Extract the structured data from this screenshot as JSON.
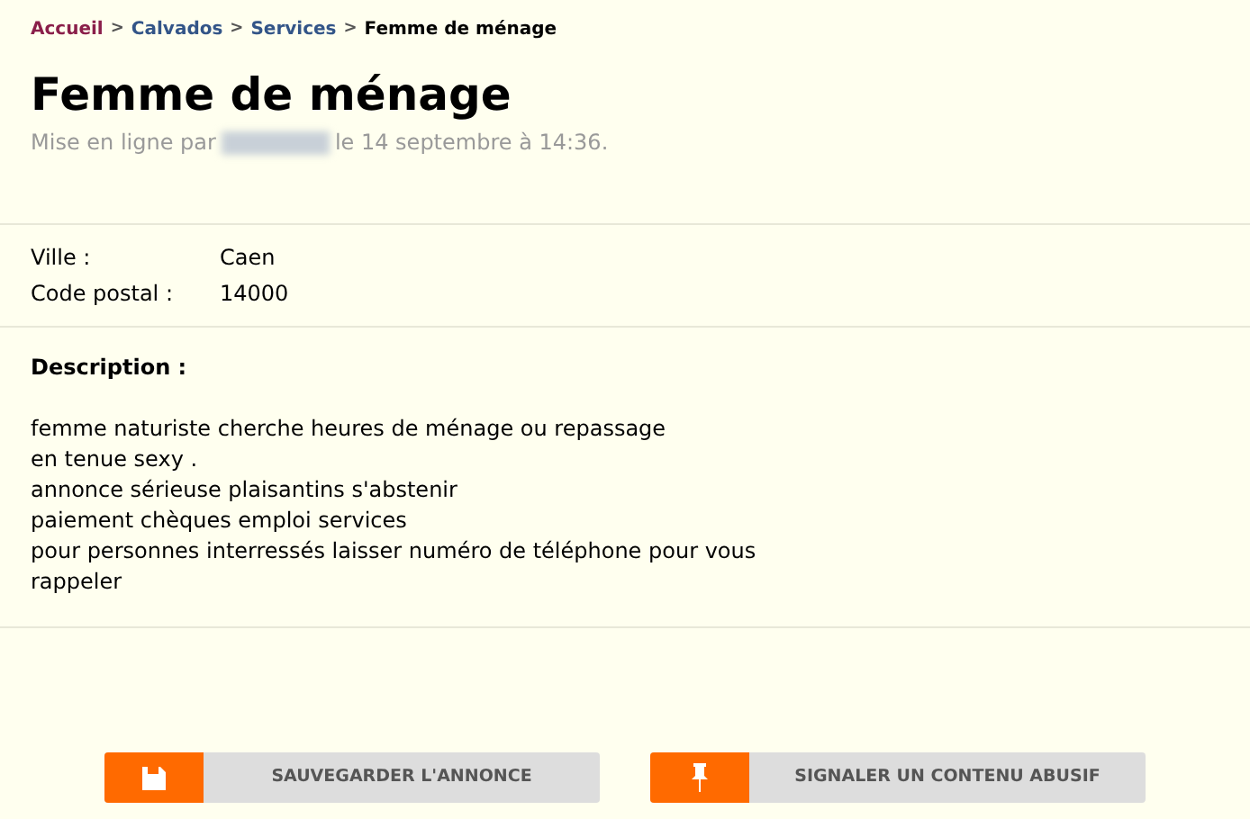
{
  "breadcrumb": [
    {
      "label": "Accueil",
      "kind": "home"
    },
    {
      "label": "Calvados",
      "kind": "link"
    },
    {
      "label": "Services",
      "kind": "link"
    },
    {
      "label": "Femme de ménage",
      "kind": "current"
    }
  ],
  "breadcrumb_separator": ">",
  "title": "Femme de ménage",
  "posted": {
    "prefix": "Mise en ligne par",
    "suffix": "le 14 septembre à 14:36."
  },
  "details": [
    {
      "label": "Ville :",
      "value": "Caen"
    },
    {
      "label": "Code postal :",
      "value": "14000"
    }
  ],
  "description": {
    "heading": "Description :",
    "lines": [
      "femme naturiste cherche heures de ménage ou repassage",
      "en tenue sexy .",
      "annonce sérieuse plaisantins s'abstenir",
      "paiement chèques emploi services",
      "pour personnes interressés laisser numéro de téléphone pour vous",
      "rappeler"
    ]
  },
  "buttons": [
    {
      "label": "SAUVEGARDER L'ANNONCE",
      "kind": "save"
    },
    {
      "label": "SIGNALER UN CONTENU ABUSIF",
      "kind": "report"
    }
  ]
}
